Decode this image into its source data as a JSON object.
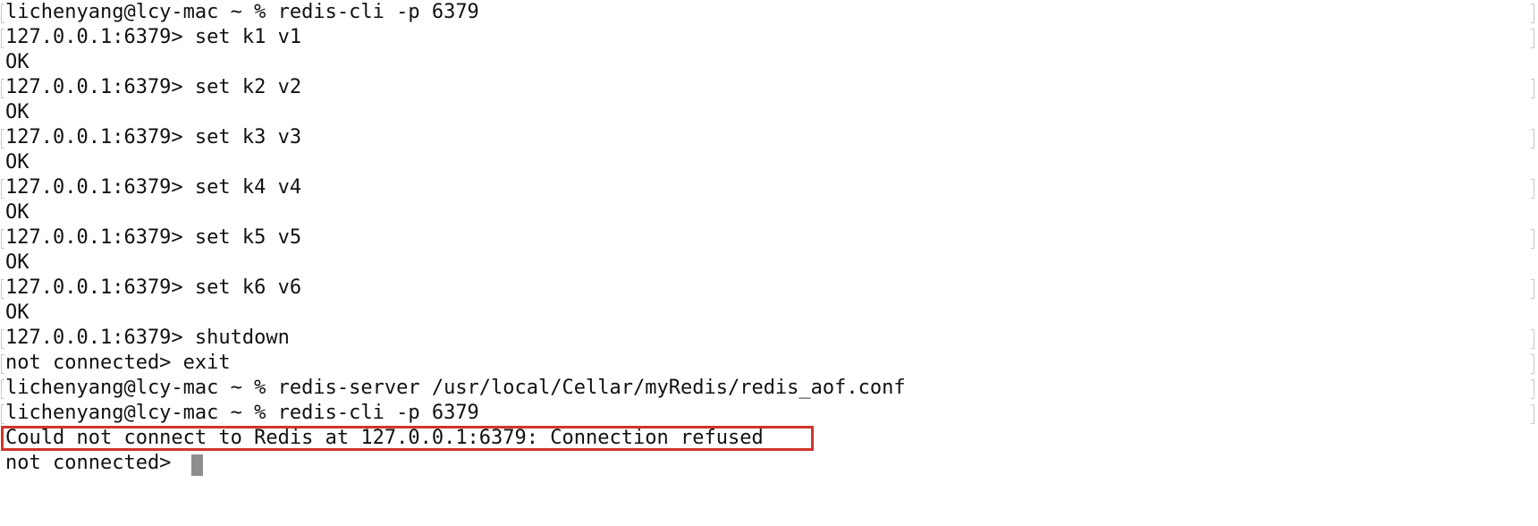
{
  "terminal": {
    "lines": [
      "lichenyang@lcy-mac ~ % redis-cli -p 6379",
      "127.0.0.1:6379> set k1 v1",
      "OK",
      "127.0.0.1:6379> set k2 v2",
      "OK",
      "127.0.0.1:6379> set k3 v3",
      "OK",
      "127.0.0.1:6379> set k4 v4",
      "OK",
      "127.0.0.1:6379> set k5 v5",
      "OK",
      "127.0.0.1:6379> set k6 v6",
      "OK",
      "127.0.0.1:6379> shutdown",
      "not connected> exit",
      "lichenyang@lcy-mac ~ % redis-server /usr/local/Cellar/myRedis/redis_aof.conf",
      "lichenyang@lcy-mac ~ % redis-cli -p 6379",
      "Could not connect to Redis at 127.0.0.1:6379: Connection refused",
      "not connected> "
    ],
    "colors": {
      "background": "#ffffff",
      "text": "#111111",
      "highlight_border": "#d0342c",
      "cursor": "#8e8e8e"
    }
  }
}
